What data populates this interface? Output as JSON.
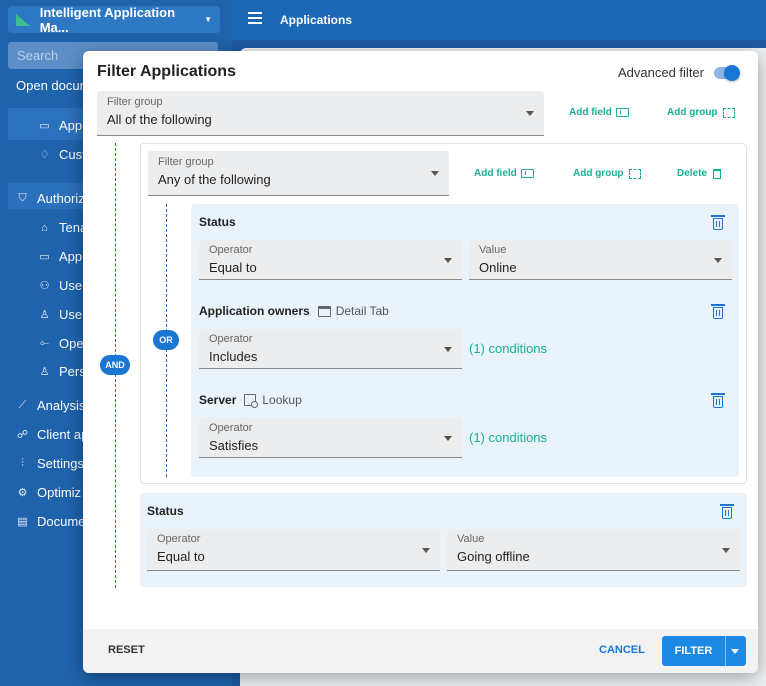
{
  "app": {
    "name": "Intelligent Application Ma...",
    "page_title": "Applications",
    "search_placeholder": "Search"
  },
  "sidebar": {
    "items": [
      {
        "label": "Open docum",
        "icon": "none"
      },
      {
        "label": "Appli",
        "icon": "monitor-icon"
      },
      {
        "label": "Custo",
        "icon": "handshake-icon"
      },
      {
        "label": "Authoriz",
        "icon": "shield-icon"
      },
      {
        "label": "Tena",
        "icon": "home-icon"
      },
      {
        "label": "Appl",
        "icon": "monitor-icon"
      },
      {
        "label": "User",
        "icon": "users-icon"
      },
      {
        "label": "User",
        "icon": "user-icon"
      },
      {
        "label": "Oper",
        "icon": "operations-icon"
      },
      {
        "label": "Pers",
        "icon": "person-icon"
      },
      {
        "label": "Analysis",
        "icon": "chart-icon"
      },
      {
        "label": "Client ap",
        "icon": "client-icon"
      },
      {
        "label": "Settings",
        "icon": "sliders-icon"
      },
      {
        "label": "Optimiz",
        "icon": "cog-icon"
      },
      {
        "label": "Docume",
        "icon": "document-icon"
      }
    ]
  },
  "modal": {
    "title": "Filter Applications",
    "advanced_filter_label": "Advanced filter",
    "advanced_filter_on": true,
    "root_group": {
      "label": "Filter group",
      "value": "All of the following",
      "add_field": "Add field",
      "add_group": "Add group",
      "connector": "AND"
    },
    "sub_group": {
      "label": "Filter group",
      "value": "Any of the following",
      "add_field": "Add field",
      "add_group": "Add group",
      "delete": "Delete",
      "connector": "OR"
    },
    "conditions": [
      {
        "title": "Status",
        "operator_label": "Operator",
        "operator": "Equal to",
        "value_label": "Value",
        "value": "Online"
      },
      {
        "title": "Application owners",
        "subtitle": "Detail Tab",
        "operator_label": "Operator",
        "operator": "Includes",
        "conditions_link": "(1) conditions"
      },
      {
        "title": "Server",
        "subtitle": "Lookup",
        "operator_label": "Operator",
        "operator": "Satisfies",
        "conditions_link": "(1) conditions"
      },
      {
        "title": "Status",
        "operator_label": "Operator",
        "operator": "Equal to",
        "value_label": "Value",
        "value": "Going offline"
      }
    ],
    "footer": {
      "reset": "RESET",
      "cancel": "CANCEL",
      "filter": "FILTER"
    }
  },
  "colors": {
    "primary": "#1976d2",
    "accent_green": "#17b096",
    "sidebar_bg": "#1f63ad"
  }
}
